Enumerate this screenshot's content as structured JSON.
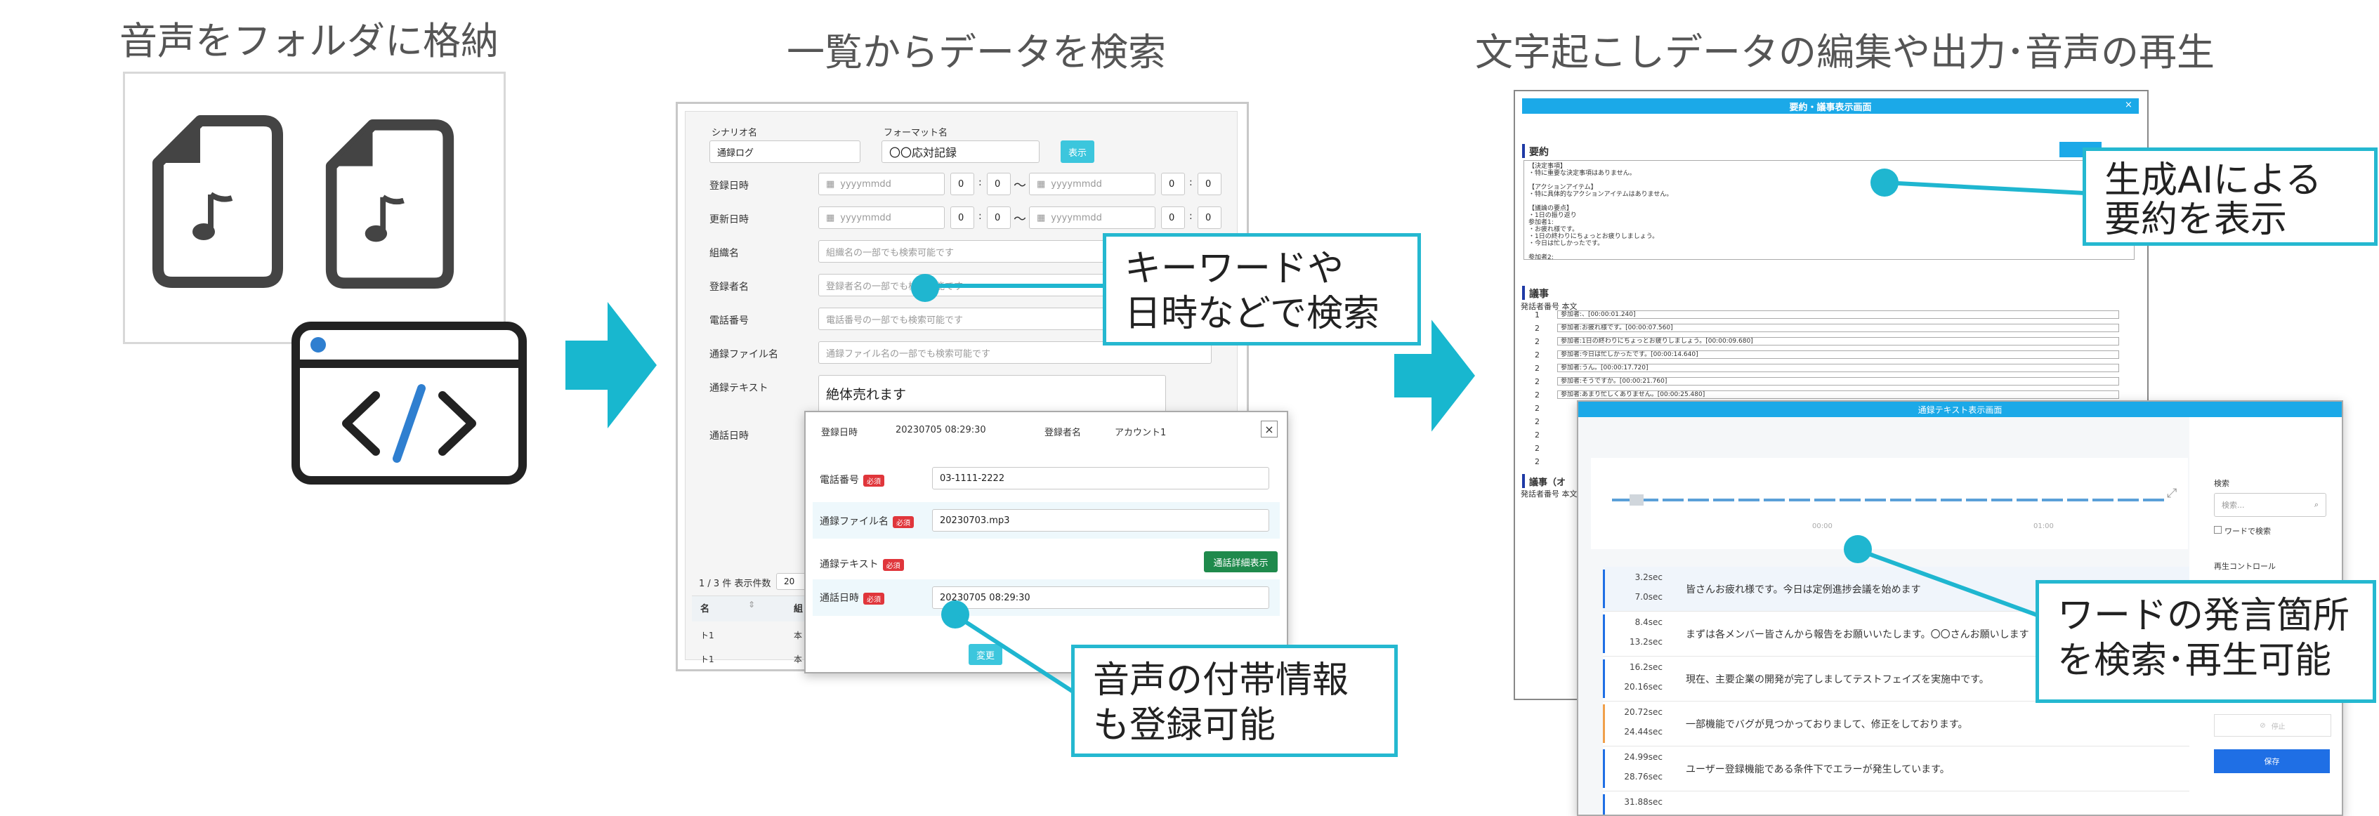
{
  "headings": {
    "step1": "音声をフォルダに格納",
    "step2": "一覧からデータを検索",
    "step3": "文字起こしデータの編集や出力･音声の再生"
  },
  "icons": {
    "audio_file": "music-note-file-icon",
    "code_window": "code-window-icon",
    "arrow": "right-arrow-icon"
  },
  "colors": {
    "accent": "#1fb6d0",
    "header_blue": "#1ba9e8",
    "dark": "#333333"
  },
  "search_form": {
    "scenario_label": "シナリオ名",
    "scenario_value": "通録ログ",
    "format_label": "フォーマット名",
    "format_value": "〇〇応対記録",
    "show_button": "表示",
    "registered_label": "登録日時",
    "updated_label": "更新日時",
    "date_placeholder": "yyyymmdd",
    "zero": "0",
    "colon": ":",
    "tilde": "〜",
    "org_label": "組織名",
    "org_placeholder": "組織名の一部でも検索可能です",
    "registrant_label": "登録者名",
    "registrant_placeholder": "登録者名の一部でも検索可能です",
    "phone_label": "電話番号",
    "phone_placeholder": "電話番号の一部でも検索可能です",
    "file_label": "通録ファイル名",
    "file_placeholder": "通録ファイル名の一部でも検索可能です",
    "text_label": "通録テキスト",
    "text_value": "絶体売れます",
    "call_datetime_label": "通話日時",
    "paging": "1 / 3 件 表示件数",
    "page_size": "20",
    "col_name": "名",
    "col_org": "組",
    "rows": [
      {
        "name": "ト1",
        "org": "本"
      },
      {
        "name": "ト1",
        "org": "本"
      }
    ]
  },
  "detail_modal": {
    "reg_datetime_label": "登録日時",
    "reg_datetime_value": "20230705 08:29:30",
    "registrant_label": "登録者名",
    "registrant_value": "アカウント1",
    "close": "×",
    "phone_label": "電話番号",
    "phone_value": "03-1111-2222",
    "file_label": "通録ファイル名",
    "file_value": "20230703.mp3",
    "text_label": "通録テキスト",
    "detail_button": "通話詳細表示",
    "call_datetime_label": "通話日時",
    "call_datetime_value": "20230705 08:29:30",
    "required": "必須",
    "change_button": "変更"
  },
  "summary_window": {
    "title": "要約・議事表示画面",
    "close": "×",
    "summary_heading": "要約",
    "summary_lines": [
      "【決定事項】",
      "・特に重要な決定事項はありません。",
      "",
      "【アクションアイテム】",
      "・特に具体的なアクションアイテムはありません。",
      "",
      "【議論の要点】",
      "・1日の振り返り",
      "参加者1:",
      "・お疲れ様です。",
      "・1日の終わりにちょっとお疲りしましょう。",
      "・今日は忙しかったです。",
      "",
      "参加者2:"
    ],
    "minutes_heading": "議事",
    "minutes_subheading": "発話者番号 本文",
    "speaker_numbers": [
      "1",
      "2",
      "2",
      "2",
      "2",
      "2",
      "2",
      "2",
      "2",
      "2",
      "2",
      "2"
    ],
    "minutes_lines": [
      "参加者:、[00:00:01.240]",
      "参加者:お疲れ様です。[00:00:07.560]",
      "参加者:1日の終わりにちょっとお疲りしましょう。[00:00:09.680]",
      "参加者:今日は忙しかったです。[00:00:14.640]",
      "参加者:うん。[00:00:17.720]",
      "参加者:そうですか。[00:00:21.760]",
      "参加者:あまり忙しくありません。[00:00:25.480]"
    ],
    "minutes2_heading": "議事（オ"
  },
  "transcript_window": {
    "title": "通録テキスト表示画面",
    "time_marks": [
      "00:00",
      "01:00"
    ],
    "search_label": "検索",
    "search_placeholder": "検索...",
    "word_search_label": "ワードで検索",
    "playback_label": "再生コントロール",
    "stop_label": "停止",
    "save_button": "保存",
    "rows": [
      {
        "start": "3.2sec",
        "end": "7.0sec",
        "text": "皆さんお疲れ様です。今日は定例進捗会議を始めます"
      },
      {
        "start": "8.4sec",
        "end": "13.2sec",
        "text": "まずは各メンバー皆さんから報告をお願いいたします。〇〇さんお願いします"
      },
      {
        "start": "16.2sec",
        "end": "20.16sec",
        "text": "現在、主要企業の開発が完了しましてテストフェイズを実施中です。"
      },
      {
        "start": "20.72sec",
        "end": "24.44sec",
        "text": "一部機能でバグが見つかっておりまして、修正をしております。"
      },
      {
        "start": "24.99sec",
        "end": "28.76sec",
        "text": "ユーザー登録機能である条件下でエラーが発生しています。"
      },
      {
        "start": "31.88sec",
        "end": "",
        "text": ""
      }
    ]
  },
  "callouts": {
    "keyword_search": [
      "キーワードや",
      "日時などで検索"
    ],
    "attach_info": [
      "音声の付帯情報",
      "も登録可能"
    ],
    "ai_summary": [
      "生成AIによる",
      "要約を表示"
    ],
    "word_playback": [
      "ワードの発言箇所",
      "を検索･再生可能"
    ]
  }
}
